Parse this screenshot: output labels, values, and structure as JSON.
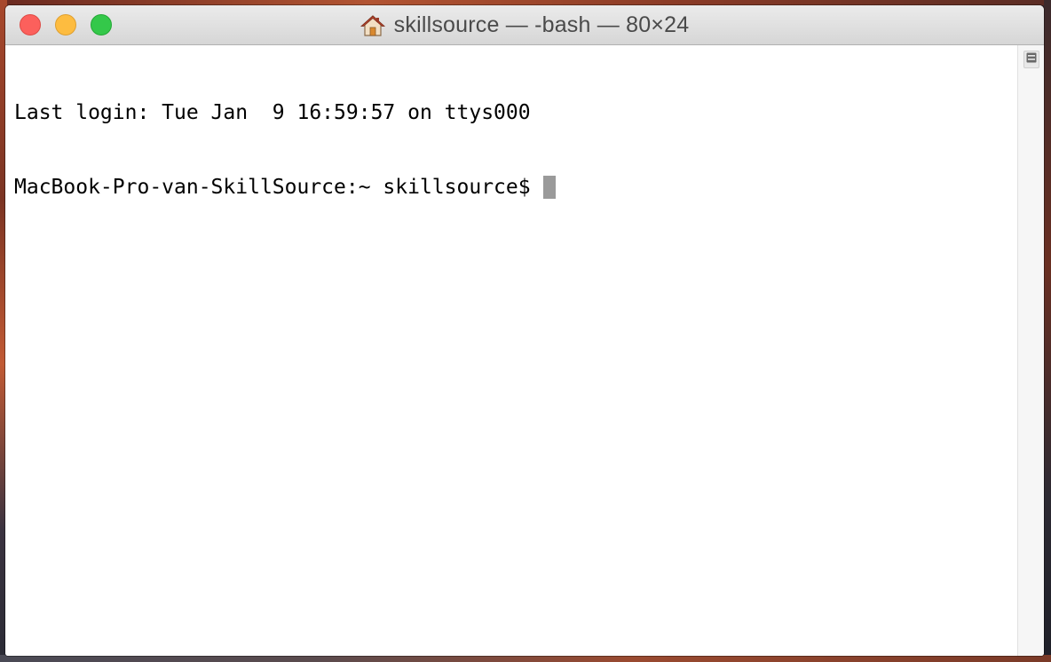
{
  "window": {
    "title": "skillsource — -bash — 80×24",
    "title_icon": "home-folder-icon"
  },
  "terminal": {
    "lines": [
      "Last login: Tue Jan  9 16:59:57 on ttys000",
      "MacBook-Pro-van-SkillSource:~ skillsource$"
    ],
    "cursor": "block-cursor"
  },
  "scrollbar": {
    "split_button_icon": "split-pane-icon"
  },
  "colors": {
    "close": "#fc605c",
    "minimize": "#fdbc40",
    "zoom": "#34c84a",
    "cursor": "#9a9a9a",
    "background": "#ffffff",
    "text": "#000000"
  }
}
